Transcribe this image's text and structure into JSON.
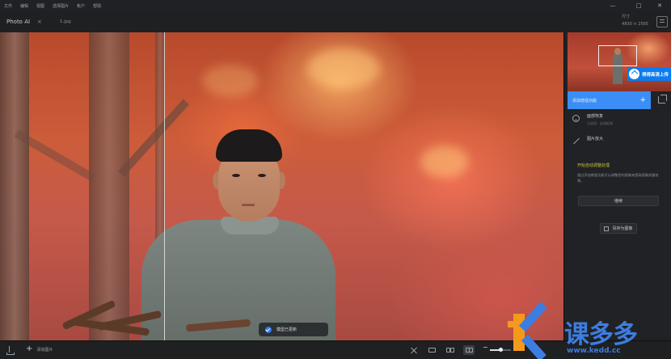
{
  "menubar": {
    "items": [
      "文件",
      "编辑",
      "视图",
      "选择图片",
      "帐户",
      "帮助"
    ]
  },
  "window_controls": {
    "minimize": "—",
    "maximize": "□",
    "close": "✕"
  },
  "titlebar": {
    "app_name": "Photo AI",
    "close_glyph": "×",
    "file_name": "1.jpg",
    "size_label": "尺寸",
    "size_value": "4830 × 2565"
  },
  "canvas": {
    "toast_text": "模型已更新"
  },
  "panel": {
    "upload_badge": "得得高清上传",
    "add_model_label": "添加增强功能",
    "add_model_plus": "+",
    "rows": [
      {
        "title": "面部恢复",
        "sub": "已启用 · 自动检测"
      },
      {
        "title": "图片放大",
        "sub": ""
      }
    ],
    "adjust_title": "开始自动调整处理",
    "adjust_desc": "通过添加增强功能可以调整您的图像来提高图像质量效果。",
    "continue_label": "继续",
    "export_label": "另存为图像"
  },
  "bottombar": {
    "add_label": "添加图片",
    "add_plus": "+",
    "zoom_level": 0.5
  },
  "watermark": {
    "text": "课多多",
    "url": "www.kedd.cc"
  },
  "colors": {
    "accent_blue": "#3a8ef6",
    "adjust_yellow": "#c5c83a",
    "logo_orange": "#f39a1d",
    "logo_blue": "#3c7de0"
  }
}
